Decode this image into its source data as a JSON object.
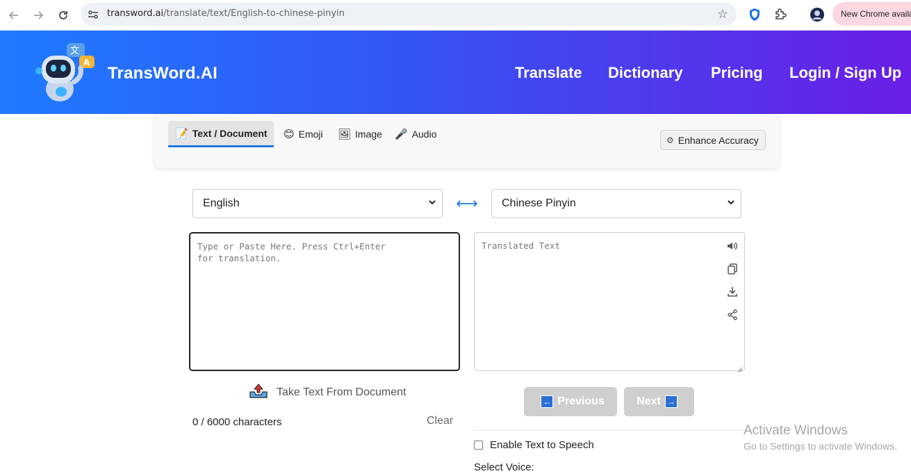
{
  "browser": {
    "url_domain": "transword.ai",
    "url_path": "/translate/text/English-to-chinese-pinyin",
    "chrome_pill": "New Chrome available",
    "icons": [
      "back-icon",
      "forward-icon",
      "reload-icon",
      "site-info-icon",
      "bookmark-star-icon",
      "shield-extension-icon",
      "extensions-puzzle-icon",
      "profile-avatar-icon"
    ]
  },
  "header": {
    "brand": "TransWord.AI",
    "nav": {
      "translate": "Translate",
      "dictionary": "Dictionary",
      "pricing": "Pricing",
      "login": "Login / Sign Up"
    },
    "gradient": [
      "#1e7bff",
      "#6a1ee6"
    ]
  },
  "tabs": {
    "text": "Text / Document",
    "emoji": "Emoji",
    "image": "Image",
    "audio": "Audio",
    "enhance": "Enhance Accuracy"
  },
  "languages": {
    "source": "English",
    "target": "Chinese Pinyin",
    "swap_symbol": "⟷"
  },
  "source": {
    "placeholder": "Type or Paste Here. Press Ctrl+Enter for translation.",
    "take_from_document": "Take Text From Document",
    "char_count": "0 / 6000 characters",
    "clear": "Clear"
  },
  "target": {
    "placeholder": "Translated Text",
    "icons": [
      "speaker-icon",
      "copy-icon",
      "download-icon",
      "share-icon"
    ]
  },
  "pager": {
    "previous": "Previous",
    "next": "Next"
  },
  "tts": {
    "enable_label": "Enable Text to Speech",
    "voice_label": "Select Voice:"
  },
  "watermark": {
    "title": "Activate Windows",
    "subtitle": "Go to Settings to activate Windows."
  }
}
